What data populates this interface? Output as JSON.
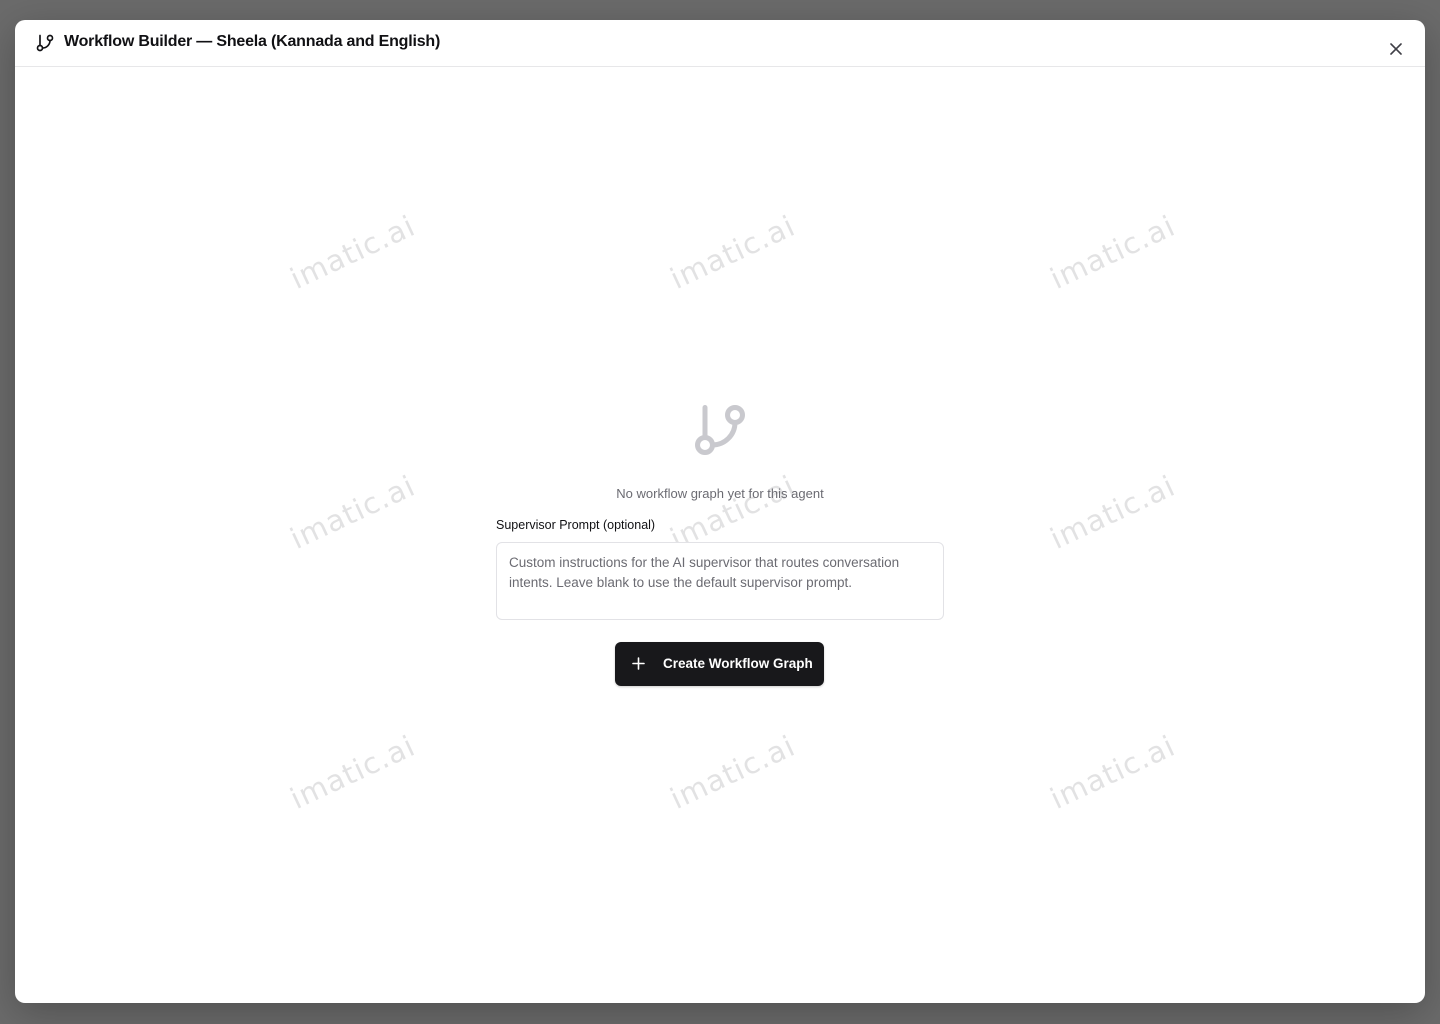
{
  "modal": {
    "title": "Workflow Builder — Sheela (Kannada and English)",
    "header_icon": "git-branch-icon",
    "close_icon": "close-icon"
  },
  "empty_state": {
    "icon": "git-branch-icon",
    "message": "No workflow graph yet for this agent"
  },
  "supervisor_prompt": {
    "label": "Supervisor Prompt (optional)",
    "value": "",
    "placeholder": "Custom instructions for the AI supervisor that routes conversation intents. Leave blank to use the default supervisor prompt."
  },
  "create_button": {
    "label": "Create Workflow Graph",
    "icon": "plus-icon"
  },
  "watermark": {
    "text": "imatic.ai"
  },
  "colors": {
    "backdrop": "#6b6b6b",
    "modal_bg": "#ffffff",
    "primary_button": "#18181b",
    "muted_text": "#6b6b72",
    "icon_muted": "#c9c9ce"
  }
}
